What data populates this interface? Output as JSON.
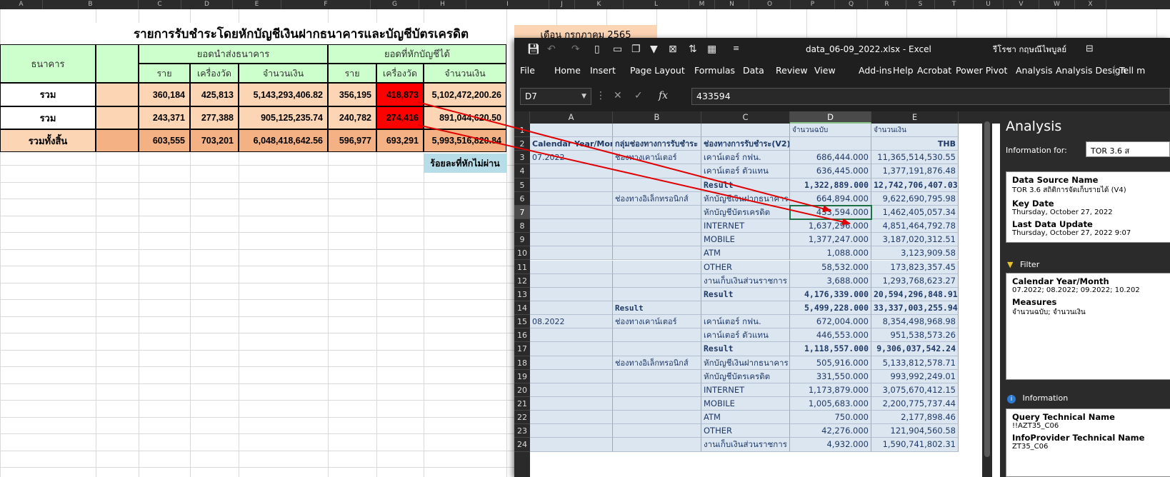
{
  "background_sheet": {
    "columns": [
      "A",
      "B",
      "C",
      "D",
      "E",
      "F",
      "G",
      "H",
      "I",
      "J",
      "K",
      "L",
      "M",
      "N",
      "O",
      "P",
      "Q",
      "R",
      "S",
      "T",
      "U",
      "V",
      "W",
      "X"
    ],
    "title": "รายการรับชำระโดยหักบัญชีเงินฝากธนาคารและบัญชีบัตรเครดิต",
    "month_label": "เดือน กรกฎาคม  2565",
    "header_bank": "ธนาคาร",
    "header_sent": "ยอดนำส่งธนาคาร",
    "header_deducted": "ยอดที่หักบัญชีได้",
    "sub_headers": [
      "ราย",
      "เครื่องวัด",
      "จำนวนเงิน",
      "ราย",
      "เครื่องวัด",
      "จำนวนเงิน"
    ],
    "rows": [
      {
        "label": "รวม",
        "values": [
          "360,184",
          "425,813",
          "5,143,293,406.82",
          "356,195",
          "418,873",
          "5,102,472,200.26"
        ]
      },
      {
        "label": "รวม",
        "values": [
          "243,371",
          "277,388",
          "905,125,235.74",
          "240,782",
          "274,416",
          "891,044,620.50"
        ]
      },
      {
        "label": "รวมทั้งสิ้น",
        "values": [
          "603,555",
          "703,201",
          "6,048,418,642.56",
          "596,977",
          "693,291",
          "5,993,516,820.84"
        ]
      }
    ],
    "fail_label": "ร้อยละที่หักไม่ผ่าน",
    "highlight_color": "#ff0000"
  },
  "excel": {
    "file_title": "data_06-09_2022.xlsx  -  Excel",
    "user_name": "รีโรชา กฤษณีไพบูลย์",
    "menu": [
      "File",
      "Home",
      "Insert",
      "Page Layout",
      "Formulas",
      "Data",
      "Review",
      "View",
      "Add-ins",
      "Help",
      "Acrobat",
      "Power Pivot",
      "Analysis",
      "Analysis Design",
      "Tell m"
    ],
    "name_box": "D7",
    "formula_value": "433594",
    "fx_label": "fx",
    "grid_columns": [
      "A",
      "B",
      "C",
      "D",
      "E"
    ],
    "header_row1": [
      "",
      "",
      "",
      "จำนวนฉบับ",
      "จำนวนเงิน"
    ],
    "header_row2": [
      "Calendar Year/Month",
      "กลุ่มช่องทางการรับชำระ",
      "ช่องทางการรับชำระ(V2)",
      "",
      "THB"
    ],
    "rows": [
      {
        "n": "3",
        "a": "07.2022",
        "b": "ช่องทางเคาน์เตอร์",
        "c": "เคาน์เตอร์ กฟน.",
        "d": "686,444.000",
        "e": "11,365,514,530.55"
      },
      {
        "n": "4",
        "a": "",
        "b": "",
        "c": "เคาน์เตอร์ ตัวแทน",
        "d": "636,445.000",
        "e": "1,377,191,876.48"
      },
      {
        "n": "5",
        "a": "",
        "b": "",
        "c": "Result",
        "d": "1,322,889.000",
        "e": "12,742,706,407.03",
        "bold": true
      },
      {
        "n": "6",
        "a": "",
        "b": "ช่องทางอิเล็กทรอนิกส์",
        "c": "หักบัญชีเงินฝากธนาคาร",
        "d": "664,894.000",
        "e": "9,622,690,795.98"
      },
      {
        "n": "7",
        "a": "",
        "b": "",
        "c": "หักบัญชีบัตรเครดิต",
        "d": "433,594.000",
        "e": "1,462,405,057.34"
      },
      {
        "n": "8",
        "a": "",
        "b": "",
        "c": "INTERNET",
        "d": "1,637,296.000",
        "e": "4,851,464,792.78"
      },
      {
        "n": "9",
        "a": "",
        "b": "",
        "c": "MOBILE",
        "d": "1,377,247.000",
        "e": "3,187,020,312.51"
      },
      {
        "n": "10",
        "a": "",
        "b": "",
        "c": "ATM",
        "d": "1,088.000",
        "e": "3,123,909.58"
      },
      {
        "n": "11",
        "a": "",
        "b": "",
        "c": "OTHER",
        "d": "58,532.000",
        "e": "173,823,357.45"
      },
      {
        "n": "12",
        "a": "",
        "b": "",
        "c": "งานเก็บเงินส่วนราชการ",
        "d": "3,688.000",
        "e": "1,293,768,623.27"
      },
      {
        "n": "13",
        "a": "",
        "b": "",
        "c": "Result",
        "d": "4,176,339.000",
        "e": "20,594,296,848.91",
        "bold": true
      },
      {
        "n": "14",
        "a": "",
        "b": "Result",
        "c": "",
        "d": "5,499,228.000",
        "e": "33,337,003,255.94",
        "bold": true
      },
      {
        "n": "15",
        "a": "08.2022",
        "b": "ช่องทางเคาน์เตอร์",
        "c": "เคาน์เตอร์ กฟน.",
        "d": "672,004.000",
        "e": "8,354,498,968.98"
      },
      {
        "n": "16",
        "a": "",
        "b": "",
        "c": "เคาน์เตอร์ ตัวแทน",
        "d": "446,553.000",
        "e": "951,538,573.26"
      },
      {
        "n": "17",
        "a": "",
        "b": "",
        "c": "Result",
        "d": "1,118,557.000",
        "e": "9,306,037,542.24",
        "bold": true
      },
      {
        "n": "18",
        "a": "",
        "b": "ช่องทางอิเล็กทรอนิกส์",
        "c": "หักบัญชีเงินฝากธนาคาร",
        "d": "505,916.000",
        "e": "5,133,812,578.71"
      },
      {
        "n": "19",
        "a": "",
        "b": "",
        "c": "หักบัญชีบัตรเครดิต",
        "d": "331,550.000",
        "e": "993,992,249.01"
      },
      {
        "n": "20",
        "a": "",
        "b": "",
        "c": "INTERNET",
        "d": "1,173,879.000",
        "e": "3,075,670,412.15"
      },
      {
        "n": "21",
        "a": "",
        "b": "",
        "c": "MOBILE",
        "d": "1,005,683.000",
        "e": "2,200,775,737.44"
      },
      {
        "n": "22",
        "a": "",
        "b": "",
        "c": "ATM",
        "d": "750.000",
        "e": "2,177,898.46"
      },
      {
        "n": "23",
        "a": "",
        "b": "",
        "c": "OTHER",
        "d": "42,276.000",
        "e": "121,904,560.58"
      },
      {
        "n": "24",
        "a": "",
        "b": "",
        "c": "งานเก็บเงินส่วนราชการ",
        "d": "4,932.000",
        "e": "1,590,741,802.31"
      }
    ],
    "analysis": {
      "title": "Analysis",
      "info_for_label": "Information for:",
      "info_for_value": "TOR 3.6 ส",
      "data_source_label": "Data Source Name",
      "data_source_value": "TOR  3.6 สถิติการจัดเก็บรายได้ (V4)",
      "key_date_label": "Key Date",
      "key_date_value": "Thursday, October 27, 2022",
      "last_update_label": "Last Data Update",
      "last_update_value": "Thursday, October 27, 2022 9:07",
      "filter_label": "Filter",
      "cal_label": "Calendar Year/Month",
      "cal_value": "07.2022; 08.2022; 09.2022; 10.202",
      "measures_label": "Measures",
      "measures_value": "จำนวนฉบับ; จำนวนเงิน",
      "information_label": "Information",
      "query_label": "Query Technical Name",
      "query_value": "!!AZT35_C06",
      "infoprovider_label": "InfoProvider Technical Name",
      "infoprovider_value": "ZT35_C06"
    }
  }
}
